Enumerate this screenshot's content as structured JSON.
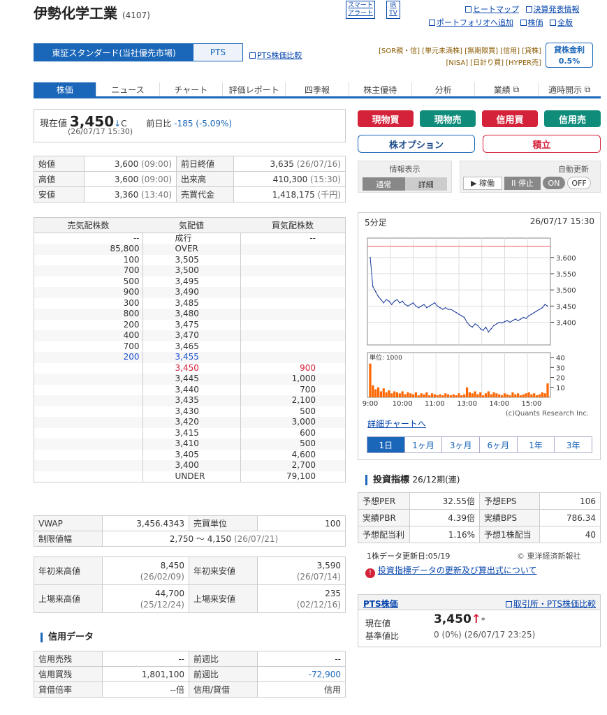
{
  "header": {
    "company": "伊勢化学工業",
    "code": "(4107)",
    "smart_alert": "スマート\nアラート",
    "ir_tv": "IR\nTV",
    "links1": [
      "ヒートマップ",
      "決算発表情報"
    ],
    "links2": [
      "ポートフォリオへ追加",
      "株価",
      "全版"
    ]
  },
  "market": {
    "primary": "東証スタンダード(当社優先市場)",
    "pts": "PTS",
    "compare": "PTS株価比較",
    "tags_line1": "[SOR親・信] [単元未満株] [無期限買] [信用] [貸株]",
    "tags_line2": "[NISA] [日計り買] [HYPER売]",
    "kashi_label": "貸株金利",
    "kashi_rate": "0.5%"
  },
  "tabs": [
    "株価",
    "ニュース",
    "チャート",
    "評価レポート",
    "四季報",
    "株主優待",
    "分析",
    "業績",
    "適時開示"
  ],
  "price": {
    "label": "現在値",
    "value": "3,450",
    "arrow": "↓",
    "mark": "C",
    "time": "(26/07/17 15:30)",
    "change_label": "前日比",
    "change": "-185 (-5.09%)"
  },
  "buttons": {
    "genbutsu_buy": "現物買",
    "genbutsu_sell": "現物売",
    "shinyo_buy": "信用買",
    "shinyo_sell": "信用売",
    "option": "株オプション",
    "tsumitate": "積立"
  },
  "info": {
    "label": "情報表示",
    "normal": "通常",
    "detail": "詳細",
    "auto_update": "自動更新",
    "running": "▶ 稼働",
    "stop": "II 停止",
    "on": "ON",
    "off": "OFF"
  },
  "ohlc": [
    {
      "l1": "始値",
      "v1": "3,600",
      "t1": "(09:00)",
      "l2": "前日終値",
      "v2": "3,635",
      "t2": "(26/07/16)"
    },
    {
      "l1": "高値",
      "v1": "3,600",
      "t1": "(09:00)",
      "l2": "出来高",
      "v2": "410,300",
      "t2": "(15:30)"
    },
    {
      "l1": "安値",
      "v1": "3,360",
      "t1": "(13:40)",
      "l2": "売買代金",
      "v2": "1,418,175",
      "t2": "(千円)"
    }
  ],
  "board": {
    "headers": [
      "売気配株数",
      "気配値",
      "買気配株数"
    ],
    "rows": [
      {
        "s": "--",
        "p": "成行",
        "b": "--"
      },
      {
        "s": "85,800",
        "p": "OVER",
        "b": ""
      },
      {
        "s": "100",
        "p": "3,505",
        "b": ""
      },
      {
        "s": "700",
        "p": "3,500",
        "b": ""
      },
      {
        "s": "500",
        "p": "3,495",
        "b": ""
      },
      {
        "s": "900",
        "p": "3,490",
        "b": ""
      },
      {
        "s": "300",
        "p": "3,485",
        "b": ""
      },
      {
        "s": "800",
        "p": "3,480",
        "b": ""
      },
      {
        "s": "200",
        "p": "3,475",
        "b": ""
      },
      {
        "s": "400",
        "p": "3,470",
        "b": ""
      },
      {
        "s": "700",
        "p": "3,465",
        "b": ""
      },
      {
        "s": "200",
        "p": "3,455",
        "b": "",
        "blue": true
      },
      {
        "s": "",
        "p": "3,450",
        "b": "900",
        "red": true
      },
      {
        "s": "",
        "p": "3,445",
        "b": "1,000"
      },
      {
        "s": "",
        "p": "3,440",
        "b": "700"
      },
      {
        "s": "",
        "p": "3,435",
        "b": "2,100"
      },
      {
        "s": "",
        "p": "3,430",
        "b": "500"
      },
      {
        "s": "",
        "p": "3,420",
        "b": "3,000"
      },
      {
        "s": "",
        "p": "3,415",
        "b": "600"
      },
      {
        "s": "",
        "p": "3,410",
        "b": "500"
      },
      {
        "s": "",
        "p": "3,405",
        "b": "4,600"
      },
      {
        "s": "",
        "p": "3,400",
        "b": "2,700"
      },
      {
        "s": "",
        "p": "UNDER",
        "b": "79,100"
      }
    ]
  },
  "vwap": {
    "l1": "VWAP",
    "v1": "3,456.4343",
    "l2": "売買単位",
    "v2": "100",
    "limit_label": "制限値幅",
    "limit": "2,750 ～ 4,150",
    "limit_date": "(26/07/21)"
  },
  "range": [
    {
      "l1": "年初来高値",
      "v1": "8,450",
      "d1": "(26/02/09)",
      "l2": "年初来安値",
      "v2": "3,590",
      "d2": "(26/07/14)"
    },
    {
      "l1": "上場来高値",
      "v1": "44,700",
      "d1": "(25/12/24)",
      "l2": "上場来安値",
      "v2": "235",
      "d2": "(02/12/16)"
    }
  ],
  "credit": {
    "title": "信用データ",
    "rows": [
      {
        "l1": "信用売残",
        "v1": "--",
        "l2": "前週比",
        "v2": "--"
      },
      {
        "l1": "信用買残",
        "v1": "1,801,100",
        "l2": "前週比",
        "v2": "-72,900"
      },
      {
        "l1": "貸借倍率",
        "v1": "--倍",
        "l2": "信用/貸借",
        "v2": "信用"
      }
    ]
  },
  "chart": {
    "period": "5分足",
    "datetime": "26/07/17 15:30",
    "unit": "単位: 1000",
    "yticks": [
      "3,600",
      "3,550",
      "3,500",
      "3,450",
      "3,400"
    ],
    "vticks": [
      "40",
      "30",
      "20",
      "10"
    ],
    "xticks": [
      "9:00",
      "10:00",
      "11:00",
      "13:00",
      "14:00",
      "15:00"
    ],
    "credit": "(c)Quants Research Inc.",
    "detail_link": "詳細チャートへ",
    "ranges": [
      "1日",
      "1ヶ月",
      "3ヶ月",
      "6ヶ月",
      "1年",
      "3年"
    ]
  },
  "chart_data": {
    "type": "line",
    "ylim": [
      3330,
      3660
    ],
    "prev_close": 3635,
    "yticks": [
      3600,
      3550,
      3500,
      3450,
      3400
    ],
    "x": [
      "9:00",
      "9:05",
      "9:10",
      "9:15",
      "9:20",
      "9:25",
      "9:30",
      "9:35",
      "9:40",
      "9:45",
      "9:50",
      "9:55",
      "10:00",
      "10:05",
      "10:10",
      "10:15",
      "10:20",
      "10:25",
      "10:30",
      "10:35",
      "10:40",
      "10:45",
      "10:50",
      "10:55",
      "11:00",
      "11:05",
      "11:10",
      "11:15",
      "11:20",
      "11:25",
      "12:30",
      "12:35",
      "12:40",
      "12:45",
      "12:50",
      "12:55",
      "13:00",
      "13:05",
      "13:10",
      "13:15",
      "13:20",
      "13:25",
      "13:30",
      "13:35",
      "13:40",
      "13:45",
      "13:50",
      "13:55",
      "14:00",
      "14:05",
      "14:10",
      "14:15",
      "14:20",
      "14:25",
      "14:30",
      "14:35",
      "14:40",
      "14:45",
      "14:50",
      "14:55",
      "15:00",
      "15:05",
      "15:10",
      "15:15",
      "15:20",
      "15:25",
      "15:30"
    ],
    "price": [
      3600,
      3510,
      3495,
      3480,
      3470,
      3460,
      3470,
      3465,
      3455,
      3465,
      3470,
      3460,
      3465,
      3455,
      3450,
      3455,
      3460,
      3450,
      3445,
      3450,
      3455,
      3445,
      3450,
      3455,
      3460,
      3450,
      3445,
      3440,
      3445,
      3440,
      3440,
      3435,
      3430,
      3425,
      3420,
      3415,
      3400,
      3390,
      3385,
      3395,
      3390,
      3380,
      3375,
      3385,
      3370,
      3380,
      3390,
      3395,
      3400,
      3398,
      3402,
      3405,
      3400,
      3405,
      3410,
      3405,
      3410,
      3415,
      3412,
      3420,
      3425,
      3430,
      3435,
      3440,
      3445,
      3455,
      3450
    ],
    "volume": [
      34,
      12,
      8,
      10,
      6,
      9,
      5,
      7,
      4,
      6,
      5,
      4,
      6,
      3,
      5,
      4,
      3,
      5,
      2,
      4,
      3,
      5,
      2,
      4,
      3,
      2,
      3,
      2,
      4,
      3,
      2,
      3,
      2,
      4,
      2,
      3,
      10,
      5,
      4,
      6,
      3,
      5,
      2,
      4,
      6,
      3,
      5,
      4,
      3,
      2,
      4,
      3,
      2,
      5,
      3,
      4,
      2,
      3,
      4,
      5,
      3,
      4,
      2,
      3,
      5,
      4,
      14
    ],
    "vlim": [
      0,
      45
    ]
  },
  "shihyo": {
    "title": "投資指標",
    "period": "26/12期(連)",
    "rows": [
      {
        "l1": "予想PER",
        "v1": "32.55倍",
        "l2": "予想EPS",
        "v2": "106"
      },
      {
        "l1": "実績PBR",
        "v1": "4.39倍",
        "l2": "実績BPS",
        "v2": "786.34"
      },
      {
        "l1": "予想配当利",
        "v1": "1.16%",
        "l2": "予想1株配当",
        "v2": "40"
      }
    ],
    "update": "1株データ更新日:05/19",
    "copyright": "© 東洋経済新報社",
    "help_link": "投資指標データの更新及び算出式について"
  },
  "pts": {
    "title": "PTS株価",
    "compare": "取引所・PTS株価比較",
    "price_label": "現在値",
    "price": "3,450",
    "arrow": "↑",
    "star": "*",
    "base_label": "基準値比",
    "base": "0 (0%)",
    "base_time": "(26/07/17 23:25)"
  }
}
